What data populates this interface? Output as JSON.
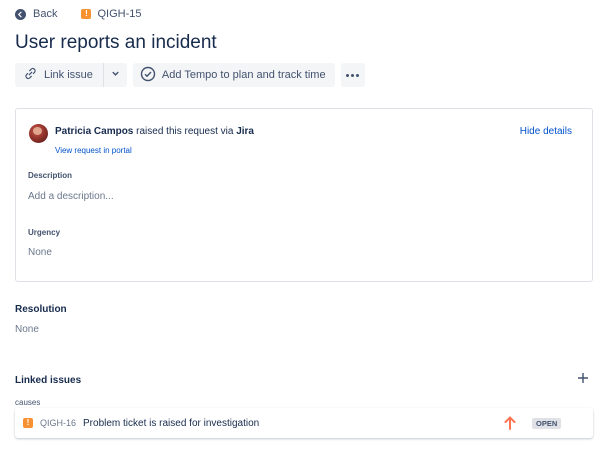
{
  "nav": {
    "back_label": "Back",
    "issue_key": "QIGH-15"
  },
  "issue": {
    "title": "User reports an incident"
  },
  "toolbar": {
    "link_issue_label": "Link issue",
    "tempo_label": "Add Tempo to plan and track time"
  },
  "request": {
    "reporter": "Patricia Campos",
    "raised_text": " raised this request via ",
    "channel": "Jira",
    "view_portal_label": "View request in portal",
    "hide_details_label": "Hide details"
  },
  "fields": {
    "description_label": "Description",
    "description_placeholder": "Add a description...",
    "urgency_label": "Urgency",
    "urgency_value": "None"
  },
  "resolution": {
    "label": "Resolution",
    "value": "None"
  },
  "linked": {
    "label": "Linked issues",
    "relation": "causes",
    "items": [
      {
        "key": "QIGH-16",
        "summary": "Problem ticket is raised for investigation",
        "status": "OPEN",
        "priority_icon": "arrow-up-icon"
      }
    ]
  },
  "colors": {
    "link": "#0052cc",
    "text": "#172b4d",
    "subtle": "#6b778c",
    "issue_icon": "#f79232",
    "priority": "#ff7452"
  }
}
